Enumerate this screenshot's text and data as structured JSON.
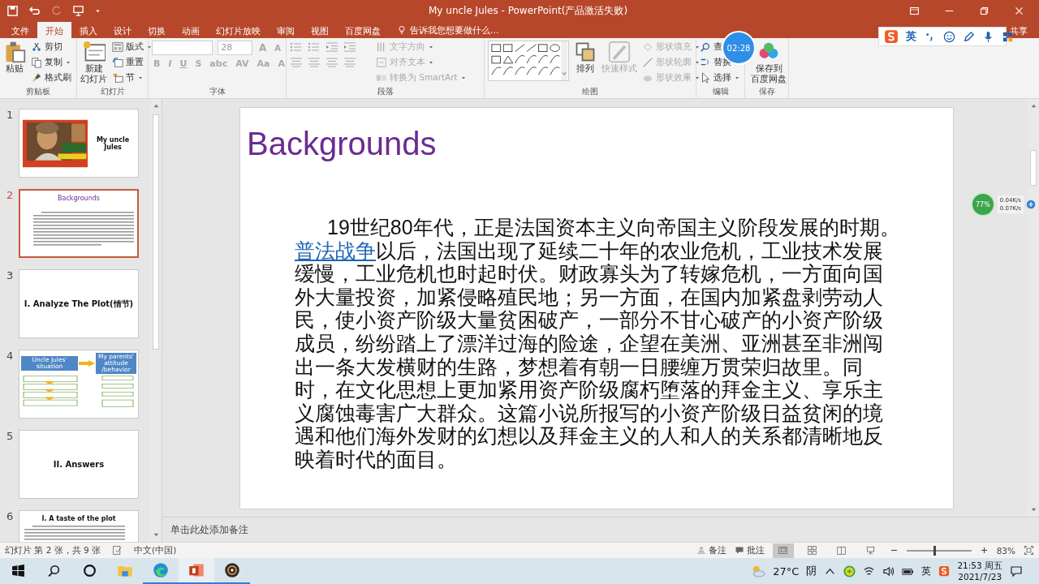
{
  "window": {
    "title": "My uncle Jules - PowerPoint(产品激活失败)"
  },
  "ribbon_tabs": [
    {
      "label": "文件",
      "selected": false
    },
    {
      "label": "开始",
      "selected": true
    },
    {
      "label": "插入",
      "selected": false
    },
    {
      "label": "设计",
      "selected": false
    },
    {
      "label": "切换",
      "selected": false
    },
    {
      "label": "动画",
      "selected": false
    },
    {
      "label": "幻灯片放映",
      "selected": false
    },
    {
      "label": "审阅",
      "selected": false
    },
    {
      "label": "视图",
      "selected": false
    },
    {
      "label": "百度网盘",
      "selected": false
    }
  ],
  "tell_me": "告诉我您想要做什么...",
  "share": "共享",
  "ribbon": {
    "clipboard": {
      "label": "剪贴板",
      "paste": "粘贴",
      "cut": "剪切",
      "copy": "复制",
      "format_painter": "格式刷"
    },
    "slides": {
      "label": "幻灯片",
      "new_slide": [
        "新建",
        "幻灯片"
      ],
      "layout": "版式",
      "reset": "重置",
      "section": "节"
    },
    "font": {
      "label": "字体",
      "disabled": true,
      "font_size": "28",
      "size_buttons": [
        "A",
        "A"
      ],
      "buttons": [
        "B",
        "I",
        "U",
        "S",
        "abc",
        "AV",
        "Aa",
        "A"
      ]
    },
    "paragraph": {
      "label": "段落",
      "commands": [
        {
          "label": "文字方向",
          "disabled": true
        },
        {
          "label": "对齐文本",
          "disabled": true
        },
        {
          "label": "转换为 SmartArt",
          "disabled": true
        }
      ]
    },
    "drawing": {
      "label": "绘图",
      "arrange": "排列",
      "quick_styles": {
        "label": "快速样式",
        "disabled": true
      },
      "commands": [
        {
          "label": "形状填充",
          "disabled": true
        },
        {
          "label": "形状轮廓",
          "disabled": true
        },
        {
          "label": "形状效果",
          "disabled": true
        }
      ]
    },
    "editing": {
      "label": "编辑",
      "find": "查",
      "replace": "替换",
      "select": "选择"
    },
    "save": {
      "label": "保存",
      "button": [
        "保存到",
        "百度网盘"
      ]
    }
  },
  "timer": "02:28",
  "ime_toolbar": {
    "mode": "英"
  },
  "net_monitor": {
    "percent": "77%",
    "upload": "0.04K/s",
    "download": "0.07K/s"
  },
  "thumbnails": [
    {
      "number": "1",
      "kind": "cover",
      "selected": false,
      "title": "My uncle Jules"
    },
    {
      "number": "2",
      "kind": "text",
      "selected": true,
      "title": "Backgrounds"
    },
    {
      "number": "3",
      "kind": "heading",
      "selected": false,
      "title": "I. Analyze The Plot(情节)"
    },
    {
      "number": "4",
      "kind": "diagram",
      "selected": false,
      "headers": [
        "Uncle Jules' situation",
        "My parents' attitude /behavior"
      ]
    },
    {
      "number": "5",
      "kind": "heading",
      "selected": false,
      "title": "II. Answers"
    },
    {
      "number": "6",
      "kind": "list",
      "selected": false,
      "title": "I. A taste of the plot"
    }
  ],
  "slide": {
    "title": "Backgrounds",
    "body": {
      "before": "19世纪80年代，正是法国资本主义向帝国主义阶段发展的时期。",
      "link": "普法战争",
      "after": "以后，法国出现了延续二十年的农业危机，工业技术发展缓慢，工业危机也时起时伏。财政寡头为了转嫁危机，一方面向国外大量投资，加紧侵略殖民地；另一方面，在国内加紧盘剥劳动人民，使小资产阶级大量贫困破产，一部分不甘心破产的小资产阶级成员，纷纷踏上了漂洋过海的险途，企望在美洲、亚洲甚至非洲闯出一条大发横财的生路，梦想着有朝一日腰缠万贯荣归故里。同时，在文化思想上更加紧用资产阶级腐朽堕落的拜金主义、享乐主义腐蚀毒害广大群众。这篇小说所报写的小资产阶级日益贫闲的境遇和他们海外发财的幻想以及拜金主义的人和人的关系都清晰地反映着时代的面目。"
    }
  },
  "notes_placeholder": "单击此处添加备注",
  "status_bar": {
    "slide_position": "幻灯片 第 2 张，共 9 张",
    "language": "中文(中国)",
    "notes": "备注",
    "comments": "批注",
    "views": [
      {
        "kind": "normal",
        "selected": true
      },
      {
        "kind": "sorter",
        "selected": false
      },
      {
        "kind": "reading",
        "selected": false
      },
      {
        "kind": "slideshow",
        "selected": false
      }
    ],
    "zoom": {
      "level": 0.42
    },
    "zoom_percent": "83%"
  },
  "taskbar": {
    "apps": [
      {
        "kind": "explorer",
        "running": false,
        "selected": false
      },
      {
        "kind": "edge",
        "running": true,
        "selected": false
      },
      {
        "kind": "powerpoint",
        "running": true,
        "selected": true
      },
      {
        "kind": "music",
        "running": true,
        "selected": false
      }
    ],
    "weather": {
      "temperature": "27°C",
      "condition": "阴"
    },
    "ime": "英",
    "time": "21:53 周五",
    "date": "2021/7/23"
  }
}
